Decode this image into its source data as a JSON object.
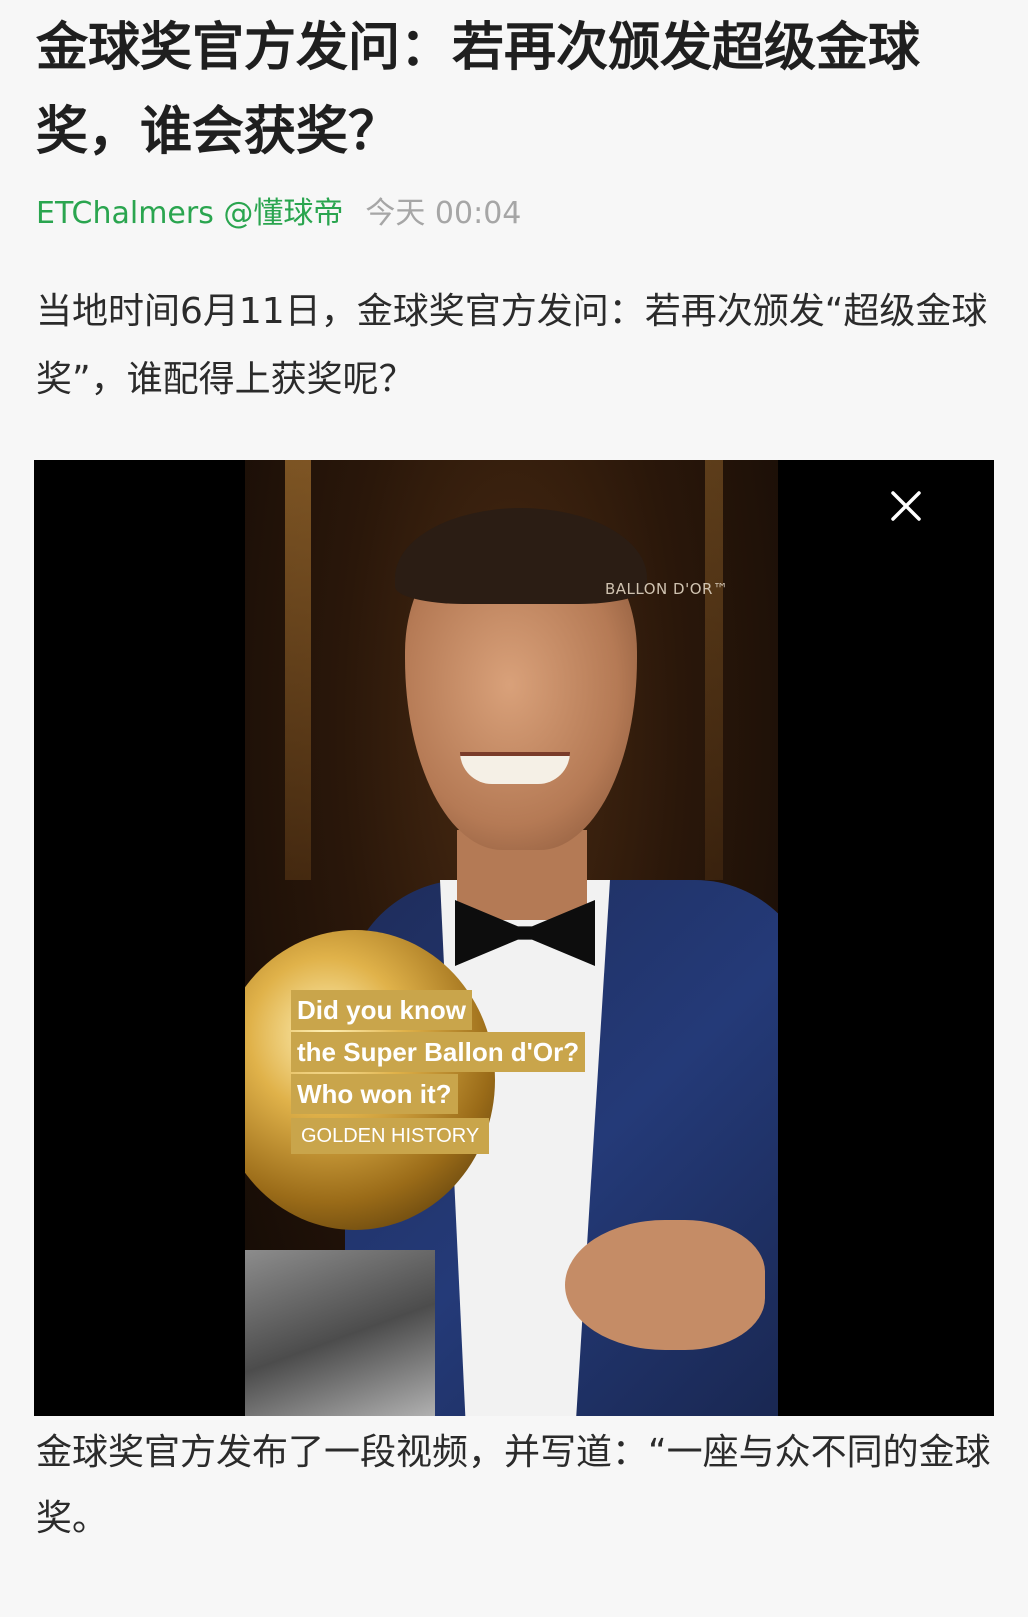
{
  "article": {
    "title": "金球奖官方发问：若再次颁发超级金球奖，谁会获奖？",
    "author": "ETChalmers @懂球帝",
    "time": "今天 00:04",
    "lead": "当地时间6月11日，金球奖官方发问：若再次颁发“超级金球奖”，谁配得上获奖呢？",
    "body": "金球奖官方发布了一段视频，并写道：“一座与众不同的金球奖。"
  },
  "video": {
    "watermark": "BALLON D'OR™",
    "overlay_lines": [
      "Did you know",
      "the Super Ballon d'Or?",
      "Who won it?"
    ],
    "overlay_sub": "GOLDEN HISTORY",
    "overlay_color": "#c9a54b",
    "close_icon": "close-icon"
  },
  "colors": {
    "author": "#2aa54f",
    "time": "#a6a6a6",
    "background": "#f7f7f7"
  }
}
